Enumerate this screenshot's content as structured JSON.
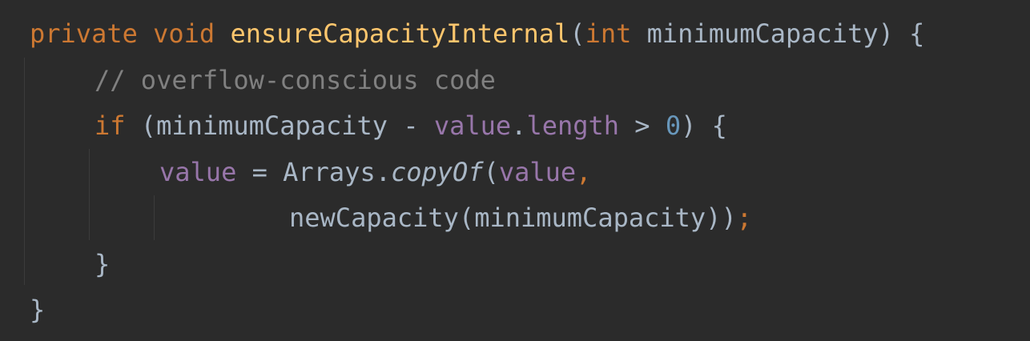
{
  "editor": {
    "lines": [
      {
        "indent": 0,
        "tokens": [
          {
            "t": "private",
            "k": "kw"
          },
          {
            "t": " ",
            "k": "pl"
          },
          {
            "t": "void",
            "k": "kw"
          },
          {
            "t": " ",
            "k": "pl"
          },
          {
            "t": "ensureCapacityInternal",
            "k": "fn"
          },
          {
            "t": "(",
            "k": "pl"
          },
          {
            "t": "int",
            "k": "kw"
          },
          {
            "t": " minimumCapacity) {",
            "k": "pl"
          }
        ]
      },
      {
        "indent": 1,
        "tokens": [
          {
            "t": "// overflow-conscious code",
            "k": "cmt"
          }
        ]
      },
      {
        "indent": 1,
        "tokens": [
          {
            "t": "if",
            "k": "kw"
          },
          {
            "t": " (minimumCapacity - ",
            "k": "pl"
          },
          {
            "t": "value",
            "k": "fld"
          },
          {
            "t": ".",
            "k": "pl"
          },
          {
            "t": "length",
            "k": "fld"
          },
          {
            "t": " > ",
            "k": "pl"
          },
          {
            "t": "0",
            "k": "num"
          },
          {
            "t": ") {",
            "k": "pl"
          }
        ]
      },
      {
        "indent": 2,
        "tokens": [
          {
            "t": "value",
            "k": "fld"
          },
          {
            "t": " = Arrays.",
            "k": "pl"
          },
          {
            "t": "copyOf",
            "k": "pl",
            "i": true
          },
          {
            "t": "(",
            "k": "pl"
          },
          {
            "t": "value",
            "k": "fld"
          },
          {
            "t": ",",
            "k": "kw"
          }
        ]
      },
      {
        "indent": 4,
        "tokens": [
          {
            "t": "newCapacity(minimumCapacity))",
            "k": "pl"
          },
          {
            "t": ";",
            "k": "kw"
          }
        ]
      },
      {
        "indent": 1,
        "tokens": [
          {
            "t": "}",
            "k": "pl"
          }
        ]
      },
      {
        "indent": 0,
        "tokens": [
          {
            "t": "}",
            "k": "pl"
          }
        ]
      }
    ]
  }
}
